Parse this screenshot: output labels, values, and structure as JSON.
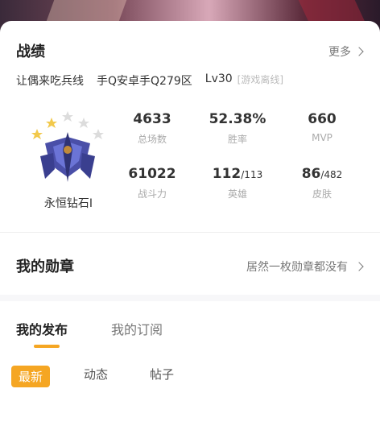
{
  "record": {
    "title": "战绩",
    "more_label": "更多",
    "player_name": "让偶来吃兵线",
    "server": "手Q安卓手Q279区",
    "level": "Lv30",
    "status_tag": "[游戏离线]",
    "rank_name": "永恒钻石I",
    "stats": [
      {
        "value": "4633",
        "label": "总场数"
      },
      {
        "value": "52.38%",
        "label": "胜率"
      },
      {
        "value": "660",
        "label": "MVP"
      },
      {
        "value": "61022",
        "label": "战斗力"
      },
      {
        "value": "112",
        "total": "/113",
        "label": "英雄"
      },
      {
        "value": "86",
        "total": "/482",
        "label": "皮肤"
      }
    ]
  },
  "medals": {
    "title": "我的勋章",
    "status": "居然一枚勋章都没有"
  },
  "posts": {
    "tabs": [
      "我的发布",
      "我的订阅"
    ],
    "filters": [
      "最新",
      "动态",
      "帖子"
    ],
    "active_color": "#f5a623"
  }
}
